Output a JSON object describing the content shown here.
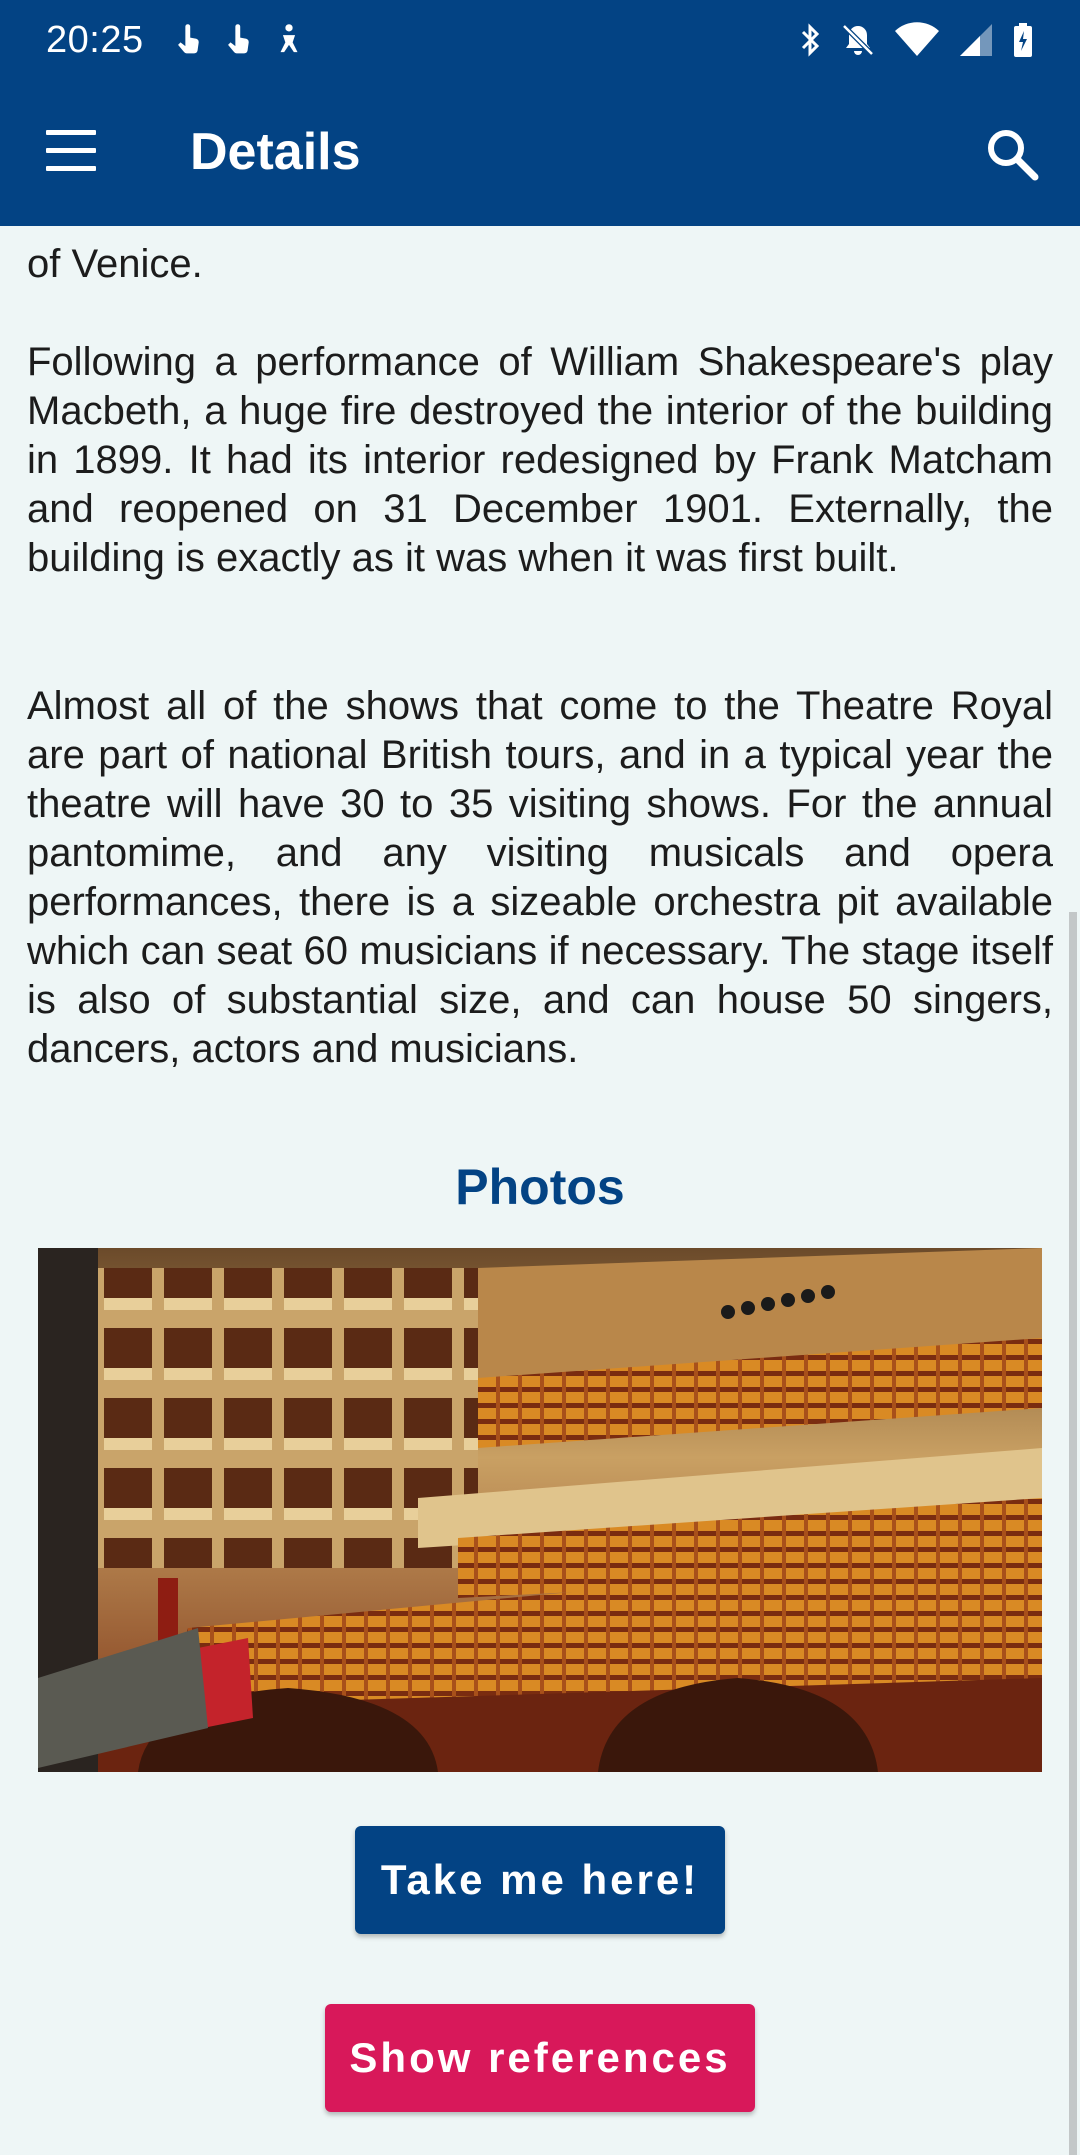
{
  "status_bar": {
    "time": "20:25",
    "notification_icons": [
      "hand-touch-icon",
      "hand-touch-icon",
      "accessibility-icon"
    ],
    "system_icons": [
      "bluetooth-icon",
      "mute-icon",
      "wifi-icon",
      "signal-icon",
      "battery-icon"
    ]
  },
  "app_bar": {
    "title": "Details",
    "menu_icon": "hamburger-menu-icon",
    "search_icon": "search-icon"
  },
  "content": {
    "paragraph_tail": "of Venice.",
    "paragraph_1": "Following a performance of William Shakespeare's play Macbeth, a huge fire destroyed the interior of the building in 1899. It had its interior redesigned by Frank Matcham and reopened on 31 December 1901. Externally, the building is exactly as it was when it was first built.",
    "paragraph_2": "Almost all of the shows that come to the Theatre Royal are part of national British tours, and in a typical year the theatre will have 30 to 35 visiting shows. For the annual pantomime, and any visiting musicals and opera performances, there is a sizeable orchestra pit available which can seat 60 musicians if necessary. The stage itself is also of substantial size, and can house 50 singers, dancers, actors and musicians.",
    "photos_heading": "Photos"
  },
  "buttons": {
    "take_me_here": "Take me here!",
    "show_references": "Show references"
  },
  "colors": {
    "primary": "#034384",
    "accent": "#d8185a",
    "background": "#eef6f6"
  }
}
